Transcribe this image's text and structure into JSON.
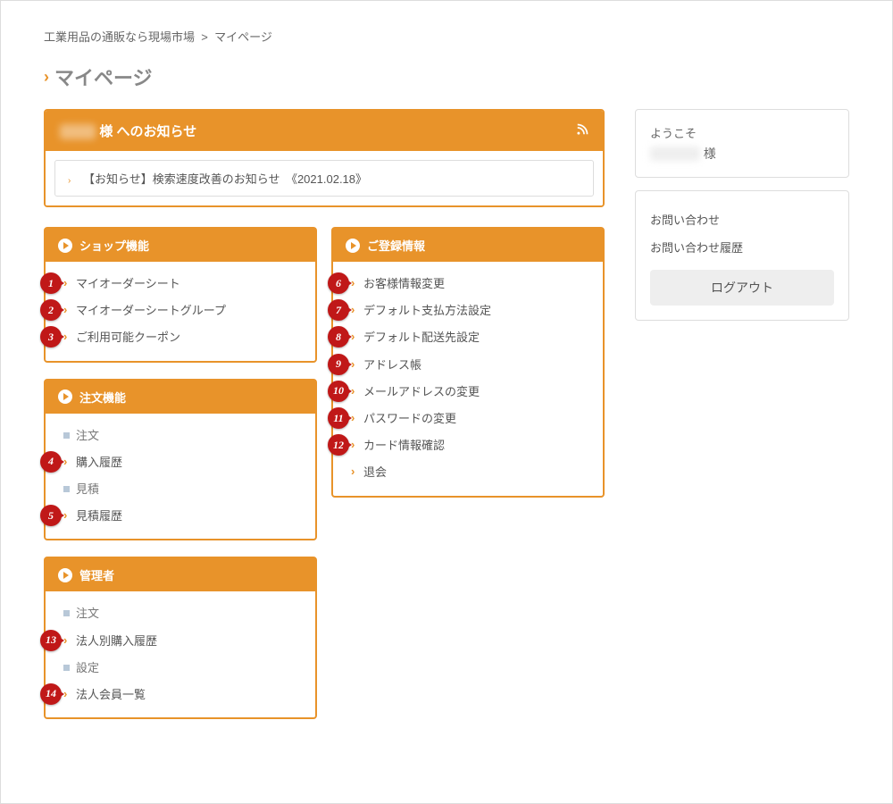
{
  "breadcrumb": {
    "root": "工業用品の通販なら現場市場",
    "sep": ">",
    "current": "マイページ"
  },
  "title": "マイページ",
  "notice": {
    "header_suffix": "様 へのお知らせ",
    "item": "【お知らせ】検索速度改善のお知らせ　《2021.02.18》"
  },
  "panels": {
    "shop": {
      "title": "ショップ機能",
      "items": [
        {
          "label": "マイオーダーシート",
          "badge": "1",
          "type": "link"
        },
        {
          "label": "マイオーダーシートグループ",
          "badge": "2",
          "type": "link"
        },
        {
          "label": "ご利用可能クーポン",
          "badge": "3",
          "type": "link"
        }
      ]
    },
    "order": {
      "title": "注文機能",
      "items": [
        {
          "label": "注文",
          "type": "header"
        },
        {
          "label": "購入履歴",
          "badge": "4",
          "type": "link"
        },
        {
          "label": "見積",
          "type": "header"
        },
        {
          "label": "見積履歴",
          "badge": "5",
          "type": "link"
        }
      ]
    },
    "admin": {
      "title": "管理者",
      "items": [
        {
          "label": "注文",
          "type": "header"
        },
        {
          "label": "法人別購入履歴",
          "badge": "13",
          "type": "link"
        },
        {
          "label": "設定",
          "type": "header"
        },
        {
          "label": "法人会員一覧",
          "badge": "14",
          "type": "link"
        }
      ]
    },
    "register": {
      "title": "ご登録情報",
      "items": [
        {
          "label": "お客様情報変更",
          "badge": "6",
          "type": "link"
        },
        {
          "label": "デフォルト支払方法設定",
          "badge": "7",
          "type": "link"
        },
        {
          "label": "デフォルト配送先設定",
          "badge": "8",
          "type": "link"
        },
        {
          "label": "アドレス帳",
          "badge": "9",
          "type": "link"
        },
        {
          "label": "メールアドレスの変更",
          "badge": "10",
          "type": "link"
        },
        {
          "label": "パスワードの変更",
          "badge": "11",
          "type": "link"
        },
        {
          "label": "カード情報確認",
          "badge": "12",
          "type": "link"
        },
        {
          "label": "退会",
          "type": "link"
        }
      ]
    }
  },
  "sidebar": {
    "welcome": "ようこそ",
    "user_suffix": "様",
    "contact": "お問い合わせ",
    "contact_history": "お問い合わせ履歴",
    "logout": "ログアウト"
  }
}
